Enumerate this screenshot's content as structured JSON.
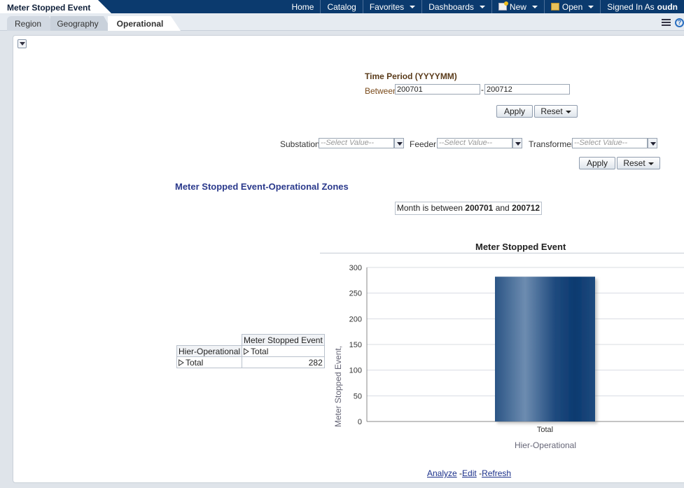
{
  "header": {
    "title": "Meter Stopped Event",
    "nav": [
      {
        "label": "Home",
        "caret": false
      },
      {
        "label": "Catalog",
        "caret": false
      },
      {
        "label": "Favorites",
        "caret": true
      },
      {
        "label": "Dashboards",
        "caret": true
      },
      {
        "label": "New",
        "caret": true,
        "icon": "new-icon"
      },
      {
        "label": "Open",
        "caret": true,
        "icon": "open-folder-icon"
      },
      {
        "label": "Signed In As",
        "caret": false
      },
      {
        "label": "oudn",
        "caret": false,
        "bold": true
      }
    ]
  },
  "tabs": [
    {
      "label": "Region"
    },
    {
      "label": "Geography"
    },
    {
      "label": "Operational",
      "active": true
    }
  ],
  "time_period": {
    "title": "Time Period (YYYYMM)",
    "between_label": "Between",
    "from_value": "200701",
    "to_value": "200712",
    "separator": "-",
    "apply_label": "Apply",
    "reset_label": "Reset"
  },
  "prompts": {
    "substation_label": "Substation",
    "feeder_label": "Feeder",
    "transformer_label": "Transformer",
    "placeholder": "--Select Value--",
    "apply_label": "Apply",
    "reset_label": "Reset"
  },
  "report": {
    "title": "Meter Stopped Event-Operational Zones",
    "filter_prefix": "Month is between",
    "filter_from": "200701",
    "filter_and": "and",
    "filter_to": "200712"
  },
  "pivot": {
    "measure_header": "Meter Stopped Event",
    "row_header": "Hier-Operational",
    "col_member": "Total",
    "row_member": "Total",
    "value": "282"
  },
  "chart_data": {
    "type": "bar",
    "title": "Meter Stopped Event",
    "xlabel": "Hier-Operational",
    "ylabel": "Meter Stopped Event,",
    "categories": [
      "Total"
    ],
    "values": [
      282
    ],
    "ylim": [
      0,
      300
    ],
    "yticks": [
      0,
      50,
      100,
      150,
      200,
      250,
      300
    ],
    "grid": true,
    "bar_color": "#1f4a7e"
  },
  "footer_links": {
    "analyze": "Analyze",
    "edit": "Edit",
    "refresh": "Refresh",
    "sep": "-"
  }
}
